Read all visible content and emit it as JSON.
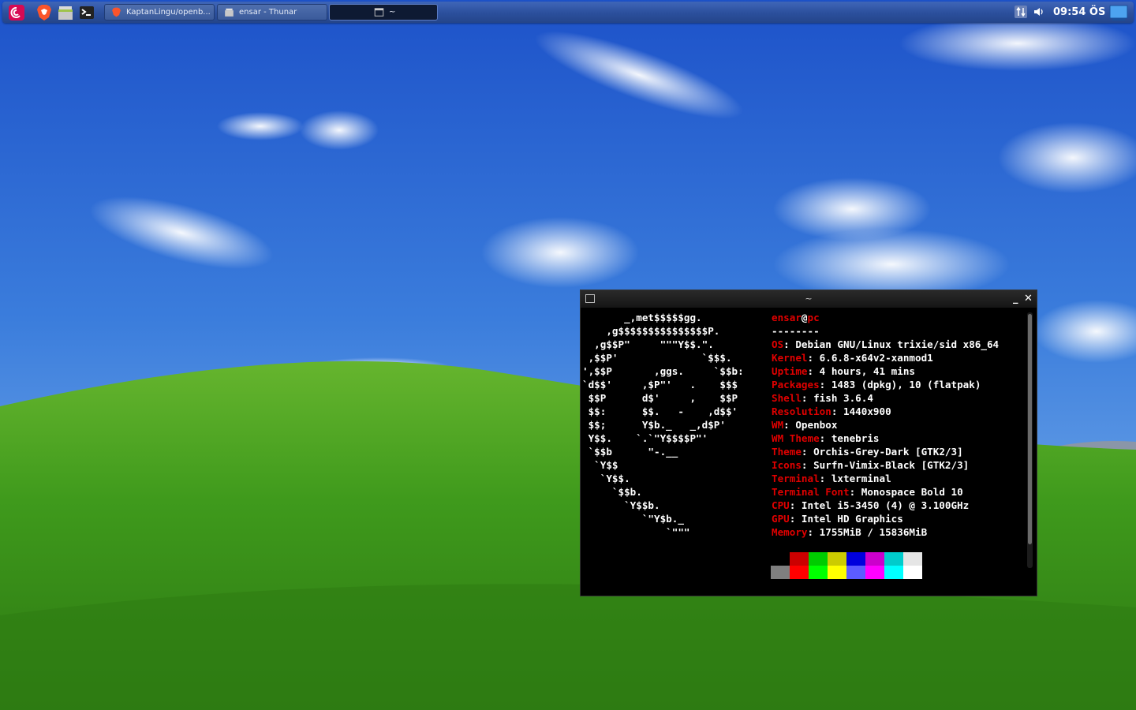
{
  "panel": {
    "launchers": [
      {
        "icon": "debian-menu-icon"
      },
      {
        "icon": "brave-browser-icon"
      },
      {
        "icon": "file-manager-icon"
      },
      {
        "icon": "terminal-icon"
      }
    ],
    "tasks": [
      {
        "label": "KaptanLingu/openb...",
        "icon": "brave-browser-icon"
      },
      {
        "label": "ensar - Thunar",
        "icon": "file-manager-icon"
      },
      {
        "label": "~",
        "icon": "terminal-icon"
      }
    ],
    "tray": {
      "network_icon": "network-transfer-icon",
      "volume_icon": "volume-icon",
      "show_desktop_icon": "show-desktop-icon"
    },
    "clock": "09:54 ÖS"
  },
  "terminal": {
    "title": "~",
    "ascii_logo": [
      "       _,met$$$$$gg.",
      "    ,g$$$$$$$$$$$$$$$P.",
      "  ,g$$P\"     \"\"\"Y$$.\".",
      " ,$$P'              `$$$.",
      "',$$P       ,ggs.     `$$b:",
      "`d$$'     ,$P\"'   .    $$$",
      " $$P      d$'     ,    $$P",
      " $$:      $$.   -    ,d$$'",
      " $$;      Y$b._   _,d$P'",
      " Y$$.    `.`\"Y$$$$P\"'",
      " `$$b      \"-.__",
      "  `Y$$",
      "   `Y$$.",
      "     `$$b.",
      "       `Y$$b.",
      "          `\"Y$b._",
      "              `\"\"\""
    ],
    "user": "ensar",
    "at": "@",
    "host": "pc",
    "separator": "--------",
    "info": [
      {
        "key": "OS",
        "value": "Debian GNU/Linux trixie/sid x86_64"
      },
      {
        "key": "Kernel",
        "value": "6.6.8-x64v2-xanmod1"
      },
      {
        "key": "Uptime",
        "value": "4 hours, 41 mins"
      },
      {
        "key": "Packages",
        "value": "1483 (dpkg), 10 (flatpak)"
      },
      {
        "key": "Shell",
        "value": "fish 3.6.4"
      },
      {
        "key": "Resolution",
        "value": "1440x900"
      },
      {
        "key": "WM",
        "value": "Openbox"
      },
      {
        "key": "WM Theme",
        "value": "tenebris"
      },
      {
        "key": "Theme",
        "value": "Orchis-Grey-Dark [GTK2/3]"
      },
      {
        "key": "Icons",
        "value": "Surfn-Vimix-Black [GTK2/3]"
      },
      {
        "key": "Terminal",
        "value": "lxterminal"
      },
      {
        "key": "Terminal Font",
        "value": "Monospace Bold 10"
      },
      {
        "key": "CPU",
        "value": "Intel i5-3450 (4) @ 3.100GHz"
      },
      {
        "key": "GPU",
        "value": "Intel HD Graphics"
      },
      {
        "key": "Memory",
        "value": "1755MiB / 15836MiB"
      }
    ],
    "palette_top": [
      "#000000",
      "#cc0000",
      "#00cc00",
      "#cccc00",
      "#0000dd",
      "#cc00cc",
      "#00cccc",
      "#e5e5e5"
    ],
    "palette_bottom": [
      "#7f7f7f",
      "#ff0000",
      "#00ff00",
      "#ffff00",
      "#5c5cff",
      "#ff00ff",
      "#00ffff",
      "#ffffff"
    ],
    "colors": {
      "key": "#e00000",
      "text": "#ffffff",
      "background": "#000000"
    }
  }
}
